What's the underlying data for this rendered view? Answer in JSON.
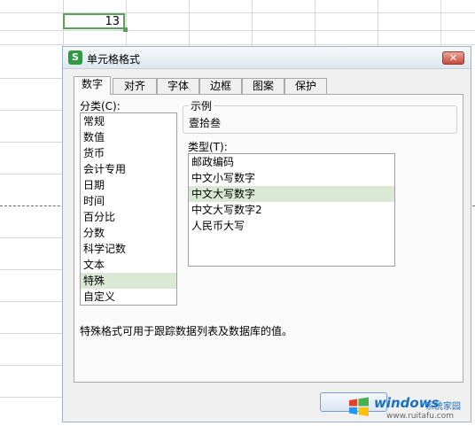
{
  "sheet": {
    "selected_cell_value": "13"
  },
  "dialog": {
    "title": "单元格格式",
    "app_icon_letter": "S",
    "close_glyph": "✕",
    "tabs": [
      {
        "label": "数字",
        "active": true
      },
      {
        "label": "对齐",
        "active": false
      },
      {
        "label": "字体",
        "active": false
      },
      {
        "label": "边框",
        "active": false
      },
      {
        "label": "图案",
        "active": false
      },
      {
        "label": "保护",
        "active": false
      }
    ],
    "category_label": "分类(C):",
    "categories": [
      "常规",
      "数值",
      "货币",
      "会计专用",
      "日期",
      "时间",
      "百分比",
      "分数",
      "科学记数",
      "文本",
      "特殊",
      "自定义"
    ],
    "selected_category": "特殊",
    "sample_label": "示例",
    "sample_value": "壹拾叁",
    "type_label": "类型(T):",
    "types": [
      "邮政编码",
      "中文小写数字",
      "中文大写数字",
      "中文大写数字2",
      "人民币大写"
    ],
    "selected_type": "中文大写数字",
    "description": "特殊格式可用于跟踪数据列表及数据库的值。"
  },
  "watermark": {
    "name": "windows",
    "sub": "系统家园",
    "url": "www.ruitafu.com"
  },
  "colors": {
    "selection_green": "#dce8d6",
    "cell_border": "#5aa05a",
    "close_red": "#c9483a"
  }
}
